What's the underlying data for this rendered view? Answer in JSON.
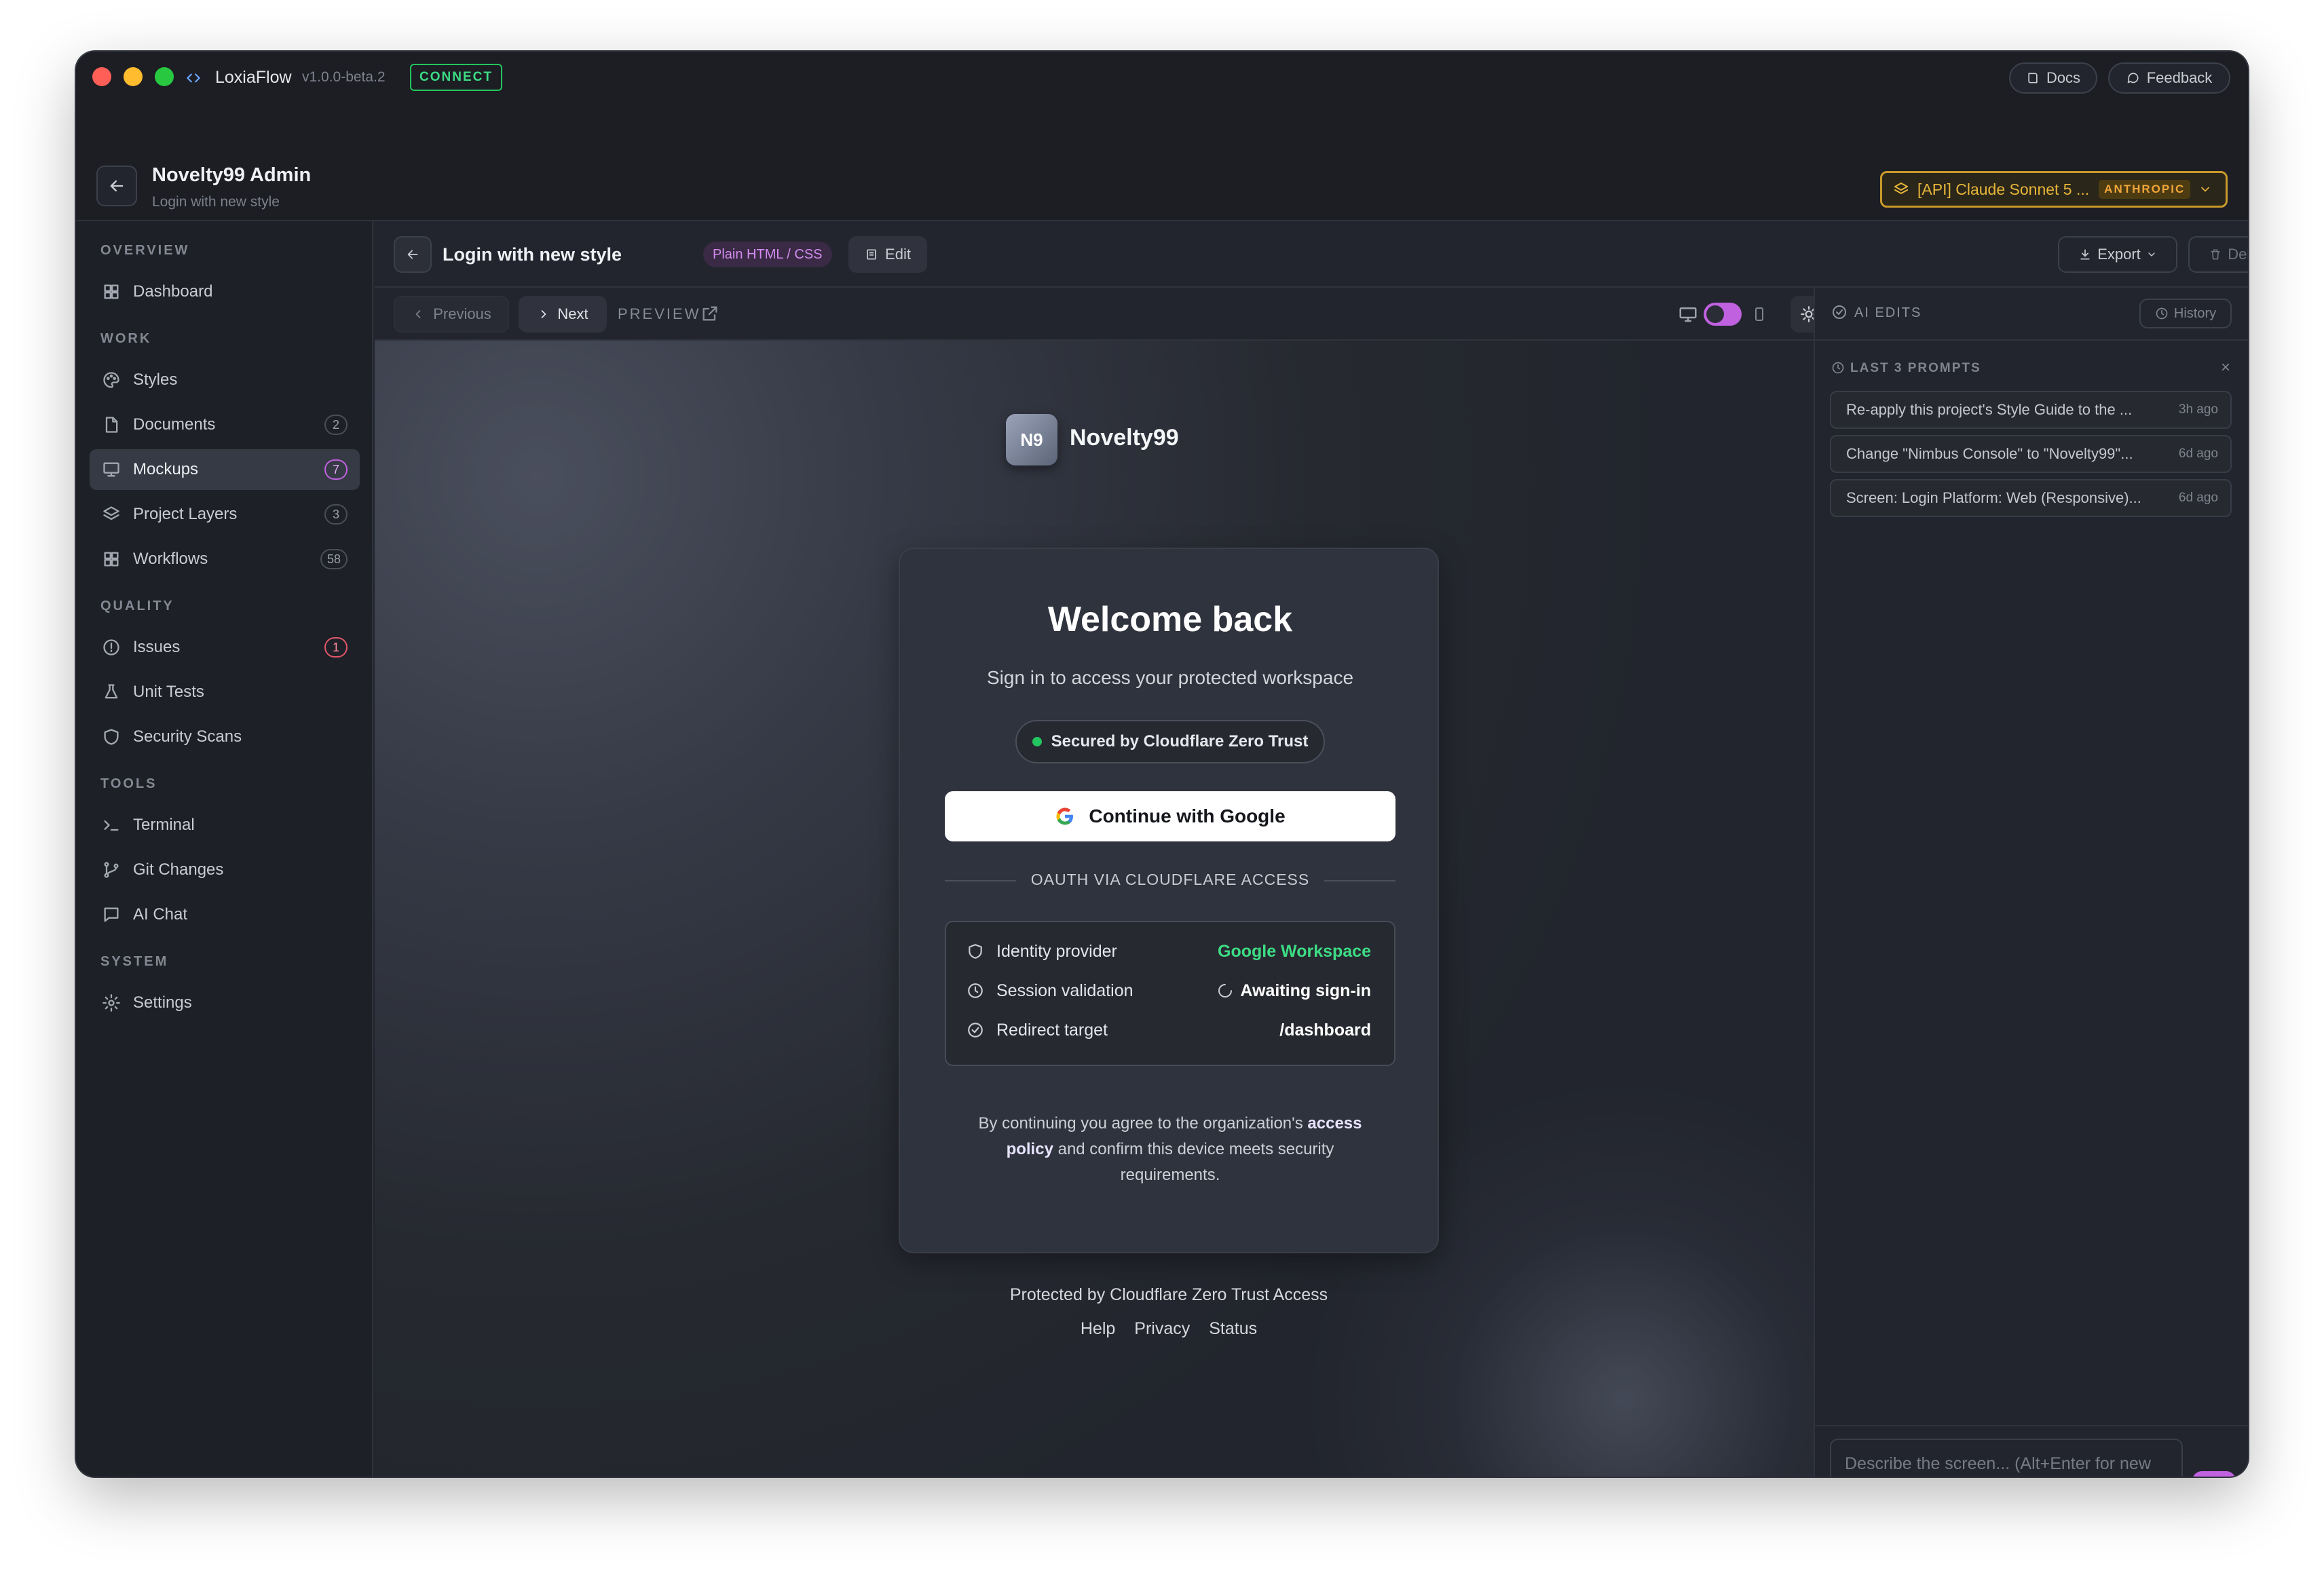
{
  "app": {
    "name": "LoxiaFlow",
    "version": "v1.0.0-beta.2",
    "connect_badge": "CONNECT",
    "docs": "Docs",
    "feedback": "Feedback"
  },
  "header": {
    "title": "Novelty99 Admin",
    "subtitle": "Login with new style",
    "model_label": "[API] Claude Sonnet 5 ...",
    "model_provider": "ANTHROPIC"
  },
  "sidebar": {
    "sections": [
      "OVERVIEW",
      "WORK",
      "QUALITY",
      "TOOLS",
      "SYSTEM"
    ],
    "items": [
      {
        "label": "Dashboard",
        "icon": "grid-icon"
      },
      {
        "label": "Styles",
        "icon": "palette-icon"
      },
      {
        "label": "Documents",
        "icon": "file-icon",
        "count": "2"
      },
      {
        "label": "Mockups",
        "icon": "monitor-icon",
        "count": "7",
        "active": true
      },
      {
        "label": "Project Layers",
        "icon": "layers-icon",
        "count": "3"
      },
      {
        "label": "Workflows",
        "icon": "grid-icon",
        "count": "58"
      },
      {
        "label": "Issues",
        "icon": "alert-circle-icon",
        "count": "1"
      },
      {
        "label": "Unit Tests",
        "icon": "flask-icon"
      },
      {
        "label": "Security Scans",
        "icon": "shield-icon"
      },
      {
        "label": "Terminal",
        "icon": "terminal-icon"
      },
      {
        "label": "Git Changes",
        "icon": "git-branch-icon"
      },
      {
        "label": "AI Chat",
        "icon": "chat-icon"
      },
      {
        "label": "Settings",
        "icon": "gear-icon"
      }
    ]
  },
  "toolbar": {
    "title": "Login with new style",
    "tag": "Plain HTML / CSS",
    "edit": "Edit",
    "export": "Export",
    "delete": "Delete"
  },
  "preview_bar": {
    "previous": "Previous",
    "next": "Next",
    "preview": "PREVIEW"
  },
  "mockup": {
    "logo_initials": "N9",
    "brand": "Novelty99",
    "heading": "Welcome back",
    "subheading": "Sign in to access your protected workspace",
    "secured_badge": "Secured by Cloudflare Zero Trust",
    "google_button": "Continue with Google",
    "divider": "OAUTH VIA CLOUDFLARE ACCESS",
    "details": [
      {
        "label": "Identity provider",
        "value": "Google Workspace",
        "icon": "shield-icon"
      },
      {
        "label": "Session validation",
        "value": "Awaiting sign-in",
        "icon": "clock-icon"
      },
      {
        "label": "Redirect target",
        "value": "/dashboard",
        "icon": "check-circle-icon"
      }
    ],
    "legal_1": "By continuing you agree to the organization's",
    "legal_link_1": "access",
    "legal_link_2": "policy",
    "legal_2": "and confirm this device meets security",
    "legal_3": "requirements.",
    "footer": "Protected by Cloudflare Zero Trust Access",
    "footer_links": [
      "Help",
      "Privacy",
      "Status"
    ]
  },
  "right_panel": {
    "title": "AI EDITS",
    "history": "History",
    "prompts_title": "LAST 3 PROMPTS",
    "prompts": [
      {
        "text": "Re-apply this project's Style Guide to the ...",
        "ago": "3h ago"
      },
      {
        "text": "Change \"Nimbus Console\" to \"Novelty99\"...",
        "ago": "6d ago"
      },
      {
        "text": "Screen: Login Platform: Web (Responsive)...",
        "ago": "6d ago"
      }
    ],
    "input_placeholder": "Describe the screen... (Alt+Enter for new line)"
  },
  "colors": {
    "accent": "#c061e0",
    "success": "#22c55e",
    "warning": "#e0a82e",
    "bg": "#22252d"
  }
}
